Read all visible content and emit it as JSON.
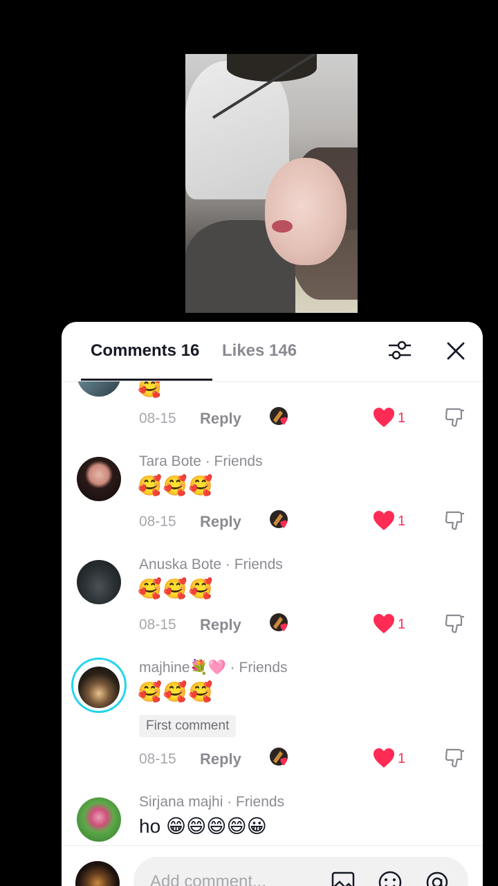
{
  "tabs": {
    "comments": "Comments 16",
    "likes": "Likes 146"
  },
  "comments": [
    {
      "emoji": "🥰",
      "date": "08-15",
      "reply": "Reply",
      "likes": "1"
    },
    {
      "name": "Tara Bote",
      "tag": " · Friends",
      "emoji": "🥰🥰🥰",
      "date": "08-15",
      "reply": "Reply",
      "likes": "1"
    },
    {
      "name": "Anuska Bote",
      "tag": " · Friends",
      "emoji": "🥰🥰🥰",
      "date": "08-15",
      "reply": "Reply",
      "likes": "1"
    },
    {
      "name": "majhine💐🩷",
      "tag": " · Friends",
      "emoji": "🥰🥰🥰",
      "badge": "First comment",
      "date": "08-15",
      "reply": "Reply",
      "likes": "1"
    },
    {
      "name": "Sirjana majhi",
      "tag": " · Friends",
      "text": "ho 😁😄😄😄😀"
    }
  ],
  "composer": {
    "placeholder": "Add comment..."
  },
  "colors": {
    "like": "#fe2c55",
    "story_ring": "#20d5ec"
  }
}
